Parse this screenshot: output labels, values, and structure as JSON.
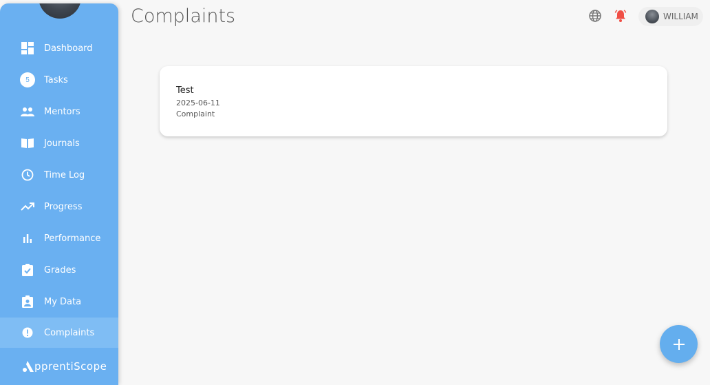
{
  "sidebar": {
    "items": [
      {
        "label": "Dashboard",
        "icon": "dashboard-icon"
      },
      {
        "label": "Tasks",
        "icon": "tasks-badge",
        "badge": "5"
      },
      {
        "label": "Mentors",
        "icon": "people-icon"
      },
      {
        "label": "Journals",
        "icon": "book-icon"
      },
      {
        "label": "Time Log",
        "icon": "clock-icon"
      },
      {
        "label": "Progress",
        "icon": "trending-up-icon"
      },
      {
        "label": "Performance",
        "icon": "bar-chart-icon"
      },
      {
        "label": "Grades",
        "icon": "clipboard-check-icon"
      },
      {
        "label": "My Data",
        "icon": "badge-icon"
      },
      {
        "label": "Complaints",
        "icon": "alert-circle-icon",
        "active": true
      }
    ],
    "brand": "pprentiScope"
  },
  "header": {
    "title": "Complaints",
    "user_name": "WILLIAM"
  },
  "complaints": [
    {
      "title": "Test",
      "date": "2025-06-11",
      "type": "Complaint"
    }
  ],
  "colors": {
    "sidebar": "#6ab0f1",
    "sidebar_active": "#7fbdf4",
    "notification": "#f04e45",
    "fab": "#64aeee"
  }
}
